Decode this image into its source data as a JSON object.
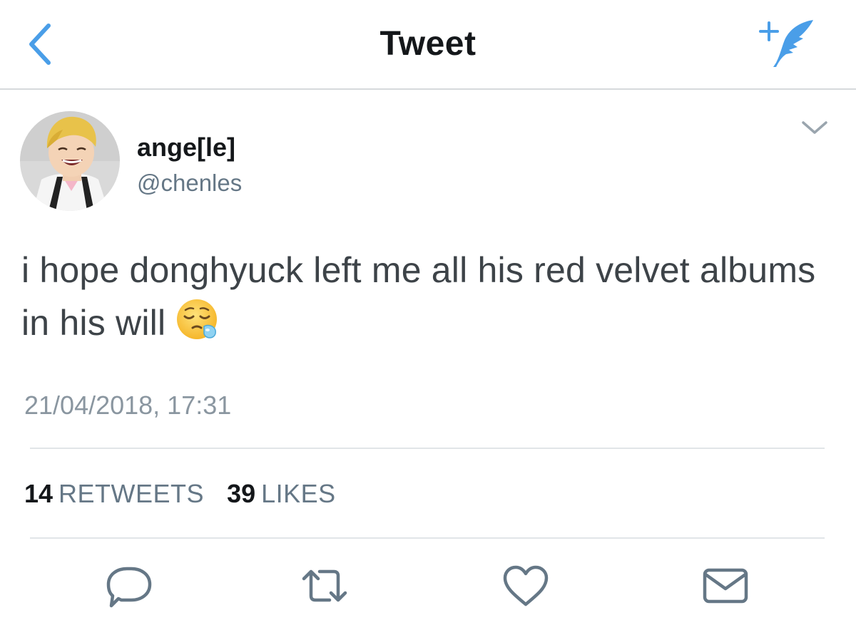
{
  "nav": {
    "title": "Tweet",
    "back_icon": "chevron-left-icon",
    "compose_icon": "compose-tweet-icon"
  },
  "tweet": {
    "display_name": "ange[le]",
    "handle": "@chenles",
    "text": "i hope donghyuck left me all his red velvet albums in his will",
    "emoji": "😪",
    "timestamp": "21/04/2018, 17:31",
    "retweets": {
      "count": "14",
      "label": "RETWEETS"
    },
    "likes": {
      "count": "39",
      "label": "LIKES"
    }
  },
  "actions": [
    {
      "name": "reply",
      "icon": "reply-icon"
    },
    {
      "name": "retweet",
      "icon": "retweet-icon"
    },
    {
      "name": "like",
      "icon": "heart-icon"
    },
    {
      "name": "direct-message",
      "icon": "envelope-icon"
    }
  ],
  "colors": {
    "accent": "#4a9ee8",
    "text_primary": "#14171a",
    "text_body": "#3d4348",
    "text_secondary": "#657786",
    "divider": "#e1e5e8"
  }
}
